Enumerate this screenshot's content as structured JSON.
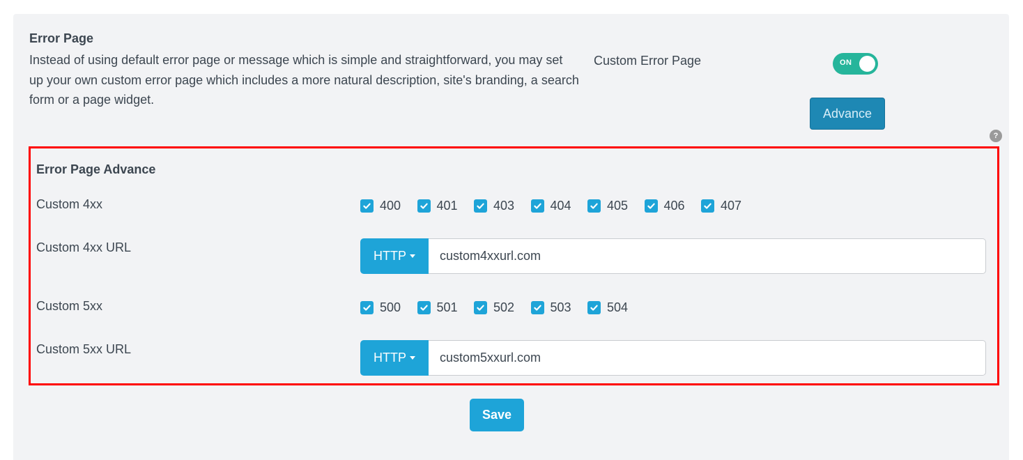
{
  "error_page": {
    "title": "Error Page",
    "description": "Instead of using default error page or message which is simple and straightforward, you may set up your own custom error page which includes a more natural description, site's branding, a search form or a page widget.",
    "option_label": "Custom Error Page",
    "toggle_state": "ON",
    "advance_label": "Advance",
    "help_label": "?"
  },
  "advance": {
    "title": "Error Page Advance",
    "custom_4xx": {
      "label": "Custom 4xx",
      "codes": [
        {
          "code": "400",
          "checked": true
        },
        {
          "code": "401",
          "checked": true
        },
        {
          "code": "403",
          "checked": true
        },
        {
          "code": "404",
          "checked": true
        },
        {
          "code": "405",
          "checked": true
        },
        {
          "code": "406",
          "checked": true
        },
        {
          "code": "407",
          "checked": true
        }
      ]
    },
    "custom_4xx_url": {
      "label": "Custom 4xx URL",
      "protocol": "HTTP",
      "value": "custom4xxurl.com"
    },
    "custom_5xx": {
      "label": "Custom 5xx",
      "codes": [
        {
          "code": "500",
          "checked": true
        },
        {
          "code": "501",
          "checked": true
        },
        {
          "code": "502",
          "checked": true
        },
        {
          "code": "503",
          "checked": true
        },
        {
          "code": "504",
          "checked": true
        }
      ]
    },
    "custom_5xx_url": {
      "label": "Custom 5xx URL",
      "protocol": "HTTP",
      "value": "custom5xxurl.com"
    }
  },
  "save_label": "Save",
  "colors": {
    "accent": "#1ea4d8",
    "toggle_on": "#26b59b",
    "highlight_border": "#ff0000",
    "advance_button": "#1e88b4"
  }
}
